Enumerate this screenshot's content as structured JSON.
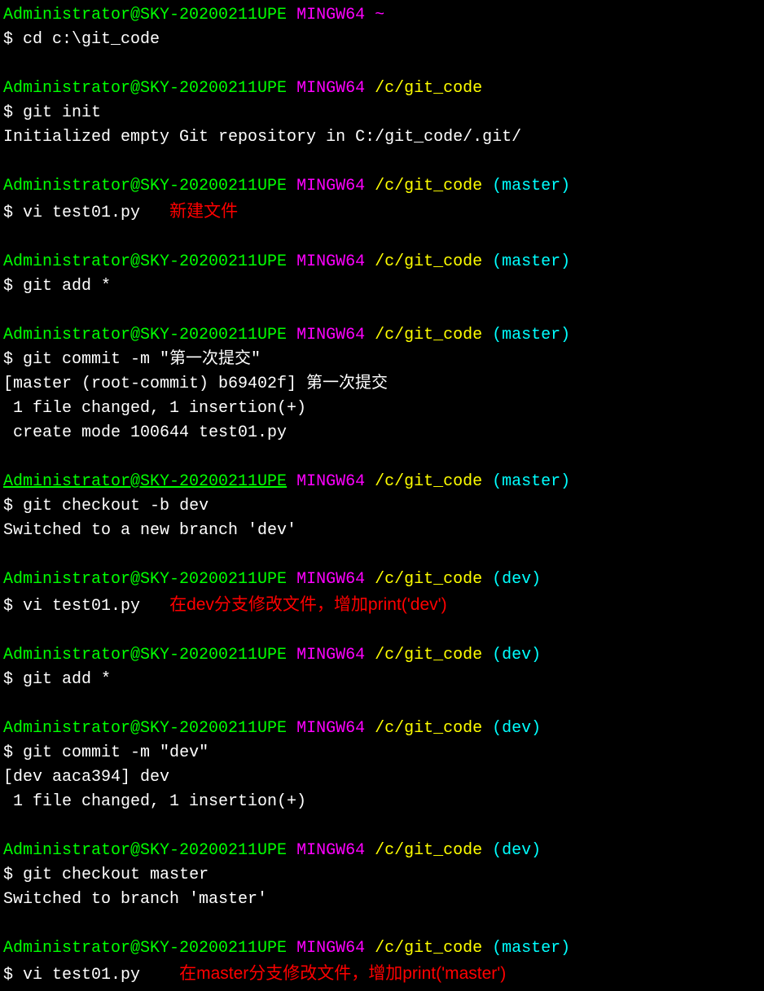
{
  "prompt": {
    "user_host": "Administrator@SKY-20200211UPE",
    "shell": "MINGW64",
    "home": "~",
    "path": "/c/git_code",
    "branch_master": "(master)",
    "branch_dev": "(dev)",
    "symbol": "$"
  },
  "blocks": [
    {
      "cmd": "cd c:\\git_code",
      "path": "~",
      "branch": ""
    },
    {
      "cmd": "git init",
      "output": "Initialized empty Git repository in C:/git_code/.git/",
      "path": "/c/git_code",
      "branch": ""
    },
    {
      "cmd": "vi test01.py",
      "path": "/c/git_code",
      "branch": "(master)",
      "annotation": "新建文件"
    },
    {
      "cmd": "git add *",
      "path": "/c/git_code",
      "branch": "(master)"
    },
    {
      "cmd": "git commit -m \"第一次提交\"",
      "output1": "[master (root-commit) b69402f] 第一次提交",
      "output2": " 1 file changed, 1 insertion(+)",
      "output3": " create mode 100644 test01.py",
      "path": "/c/git_code",
      "branch": "(master)"
    },
    {
      "cmd": "git checkout -b dev",
      "output": "Switched to a new branch 'dev'",
      "path": "/c/git_code",
      "branch": "(master)",
      "underline": true
    },
    {
      "cmd": "vi test01.py",
      "path": "/c/git_code",
      "branch": "(dev)",
      "annotation": "在dev分支修改文件，增加print('dev')"
    },
    {
      "cmd": "git add *",
      "path": "/c/git_code",
      "branch": "(dev)"
    },
    {
      "cmd": "git commit -m \"dev\"",
      "output1": "[dev aaca394] dev",
      "output2": " 1 file changed, 1 insertion(+)",
      "path": "/c/git_code",
      "branch": "(dev)"
    },
    {
      "cmd": "git checkout master",
      "output": "Switched to branch 'master'",
      "path": "/c/git_code",
      "branch": "(dev)"
    },
    {
      "cmd": "vi test01.py",
      "path": "/c/git_code",
      "branch": "(master)",
      "annotation": "在master分支修改文件，增加print('master')"
    }
  ]
}
